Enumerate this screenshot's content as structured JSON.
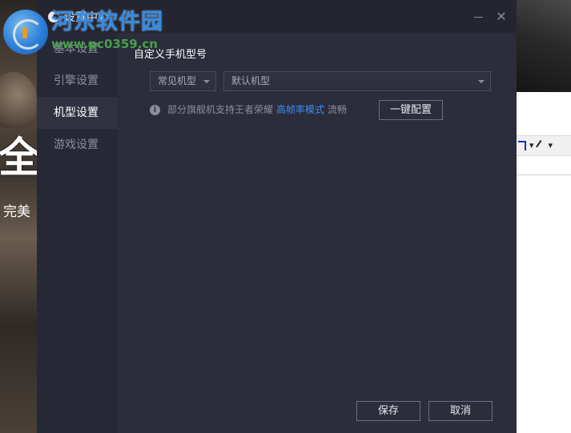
{
  "dialog": {
    "title": "设置中心"
  },
  "sidebar": {
    "items": [
      {
        "label": "基本设置",
        "active": false
      },
      {
        "label": "引擎设置",
        "active": false
      },
      {
        "label": "机型设置",
        "active": true
      },
      {
        "label": "游戏设置",
        "active": false
      }
    ]
  },
  "device": {
    "section_title": "自定义手机型号",
    "common_select_value": "常见机型",
    "model_select_value": "默认机型",
    "info_prefix": "部分旗舰机支持王者荣耀",
    "info_link": "高帧率模式",
    "info_suffix": "流畅",
    "one_key_label": "一键配置"
  },
  "footer": {
    "save_label": "保存",
    "cancel_label": "取消"
  },
  "background": {
    "big_char": "全",
    "small_text": "完美"
  },
  "watermark": {
    "name": "河东软件园",
    "url": "www.pc0359.cn"
  },
  "colors": {
    "dialog_bg": "#2c2d3b",
    "sidebar_bg": "#272835",
    "link": "#3d8bf2",
    "watermark_name": "#2f8de8",
    "watermark_url": "#46a14a"
  }
}
